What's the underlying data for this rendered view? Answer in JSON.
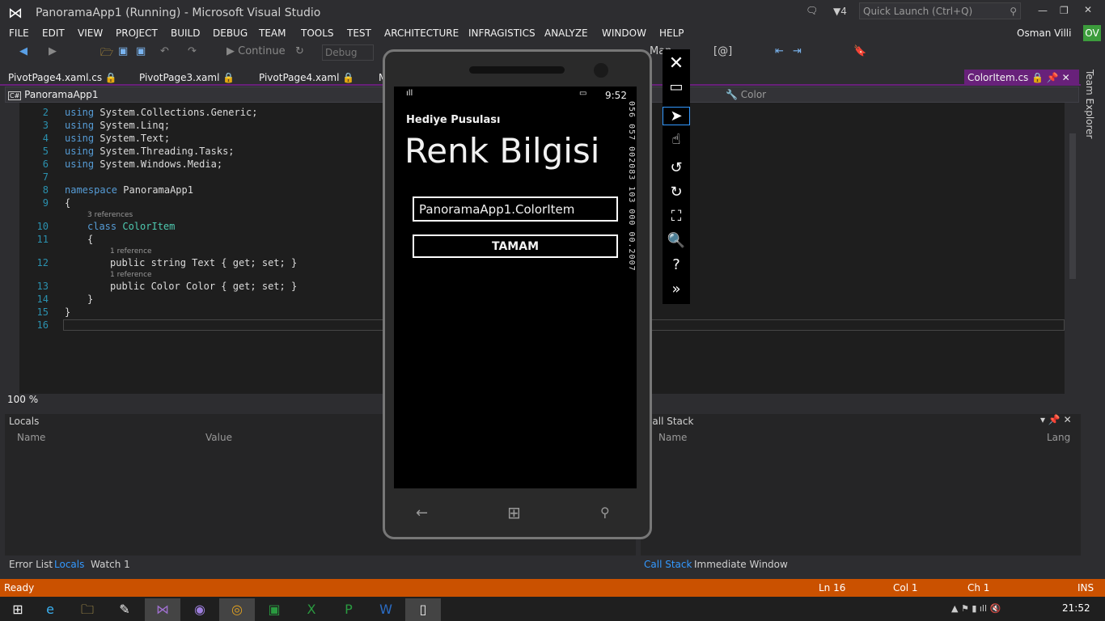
{
  "window": {
    "title": "PanoramaApp1 (Running) - Microsoft Visual Studio",
    "notifications": "4",
    "quick_launch_placeholder": "Quick Launch (Ctrl+Q)",
    "user": "Osman Villi",
    "user_initials": "OV"
  },
  "menu": [
    "FILE",
    "EDIT",
    "VIEW",
    "PROJECT",
    "BUILD",
    "DEBUG",
    "TEAM",
    "TOOLS",
    "TEST",
    "ARCHITECTURE",
    "INFRAGISTICS",
    "ANALYZE",
    "WINDOW",
    "HELP"
  ],
  "toolbar": {
    "continue": "Continue",
    "config": "Debug",
    "map": "Map"
  },
  "tabs": [
    "PivotPage4.xaml.cs",
    "PivotPage3.xaml",
    "PivotPage4.xaml",
    "M"
  ],
  "active_tab": "ColorItem.cs",
  "nav": {
    "project": "PanoramaApp1",
    "member": "Color"
  },
  "code": {
    "lines": [
      "2",
      "3",
      "4",
      "5",
      "6",
      "7",
      "8",
      "9",
      "10",
      "11",
      "12",
      "13",
      "14",
      "15",
      "16"
    ],
    "usings": [
      "System.Collections.Generic;",
      "System.Linq;",
      "System.Text;",
      "System.Threading.Tasks;",
      "System.Windows.Media;"
    ],
    "using_kw": "using",
    "namespace_kw": "namespace",
    "namespace_name": "PanoramaApp1",
    "class_kw": "class",
    "class_name": "ColorItem",
    "refs3": "3 references",
    "refs1": "1 reference",
    "prop1": "public string Text { get; set; }",
    "prop2": "public Color Color { get; set; }",
    "open": "{",
    "close": "}"
  },
  "zoom": "100 %",
  "locals": {
    "title": "Locals",
    "cols": [
      "Name",
      "Value"
    ]
  },
  "callstack": {
    "title": "Call Stack",
    "cols": [
      "Name",
      "Lang"
    ]
  },
  "bottom_tabs_left": [
    "Error List",
    "Locals",
    "Watch 1"
  ],
  "bottom_tabs_right": [
    "Call Stack",
    "Immediate Window"
  ],
  "status": {
    "state": "Ready",
    "ln": "Ln 16",
    "col": "Col 1",
    "ch": "Ch 1",
    "mode": "INS"
  },
  "phone": {
    "time": "9:52",
    "app_title": "Hediye Pusulası",
    "page_title": "Renk Bilgisi",
    "textbox": "PanoramaApp1.ColorItem",
    "button": "TAMAM",
    "counters": "056 057 002083 103 000 00.2007"
  },
  "clock": "21:52",
  "team_explorer": "Team Explorer"
}
